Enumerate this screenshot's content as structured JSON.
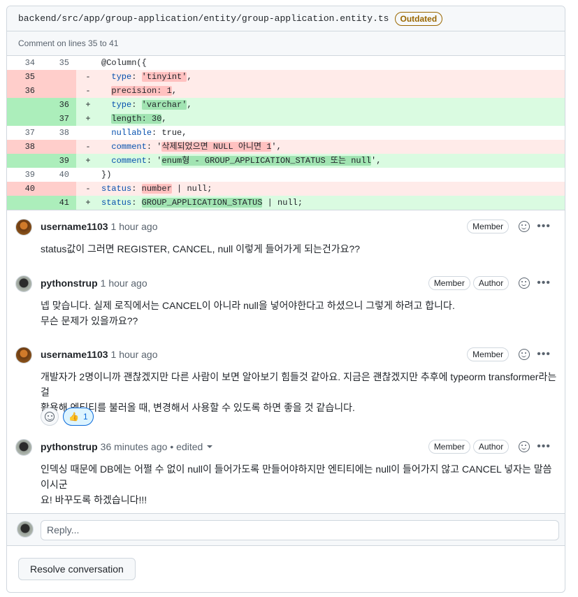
{
  "header": {
    "file_path": "backend/src/app/group-application/entity/group-application.entity.ts",
    "outdated_label": "Outdated"
  },
  "comment_lines": "Comment on lines 35 to 41",
  "diff": [
    {
      "type": "ctx",
      "old": "34",
      "new": "35",
      "sign": "",
      "code": "@Column({"
    },
    {
      "type": "del",
      "old": "35",
      "new": "",
      "sign": "-",
      "code": "  type: 'tinyint',"
    },
    {
      "type": "del",
      "old": "36",
      "new": "",
      "sign": "-",
      "code": "  precision: 1,"
    },
    {
      "type": "add",
      "old": "",
      "new": "36",
      "sign": "+",
      "code": "  type: 'varchar',"
    },
    {
      "type": "add",
      "old": "",
      "new": "37",
      "sign": "+",
      "code": "  length: 30,"
    },
    {
      "type": "ctx",
      "old": "37",
      "new": "38",
      "sign": "",
      "code": "  nullable: true,"
    },
    {
      "type": "del",
      "old": "38",
      "new": "",
      "sign": "-",
      "code": "  comment: '삭제되었으면 NULL 아니면 1',"
    },
    {
      "type": "add",
      "old": "",
      "new": "39",
      "sign": "+",
      "code": "  comment: 'enum형 - GROUP_APPLICATION_STATUS 또는 null',"
    },
    {
      "type": "ctx",
      "old": "39",
      "new": "40",
      "sign": "",
      "code": "})"
    },
    {
      "type": "del",
      "old": "40",
      "new": "",
      "sign": "-",
      "code": "status: number | null;"
    },
    {
      "type": "add",
      "old": "",
      "new": "41",
      "sign": "+",
      "code": "status: GROUP_APPLICATION_STATUS | null;"
    }
  ],
  "comments": [
    {
      "user": "username1103",
      "time": "1 hour ago",
      "edited": "",
      "badges": [
        "Member"
      ],
      "body": [
        "status값이 그러면 REGISTER, CANCEL, null 이렇게 들어가게 되는건가요??"
      ]
    },
    {
      "user": "pythonstrup",
      "time": "1 hour ago",
      "edited": "",
      "badges": [
        "Member",
        "Author"
      ],
      "body": [
        "넵 맞습니다. 실제 로직에서는 CANCEL이 아니라 null을 넣어야한다고 하셨으니 그렇게 하려고 합니다.",
        "무슨 문제가 있을까요??"
      ]
    },
    {
      "user": "username1103",
      "time": "1 hour ago",
      "edited": "",
      "badges": [
        "Member"
      ],
      "body": [
        "개발자가 2명이니까 괜찮겠지만 다른 사람이 보면 알아보기 힘들것 같아요. 지금은 괜찮겠지만 추후에 typeorm transformer라는 걸",
        "활용해 엔티티를 불러올 때, 변경해서 사용할 수 있도록 하면 좋을 것 같습니다."
      ],
      "reaction": {
        "emoji": "👍",
        "count": "1"
      }
    },
    {
      "user": "pythonstrup",
      "time": "36 minutes ago",
      "edited": "• edited",
      "badges": [
        "Member",
        "Author"
      ],
      "body": [
        "인덱싱 때문에 DB에는 어쩔 수 없이 null이 들어가도록 만들어야하지만 엔티티에는 null이 들어가지 않고 CANCEL 넣자는 말씀이시군",
        "요! 바꾸도록 하겠습니다!!!"
      ]
    }
  ],
  "reply": {
    "placeholder": "Reply..."
  },
  "resolve_label": "Resolve conversation"
}
